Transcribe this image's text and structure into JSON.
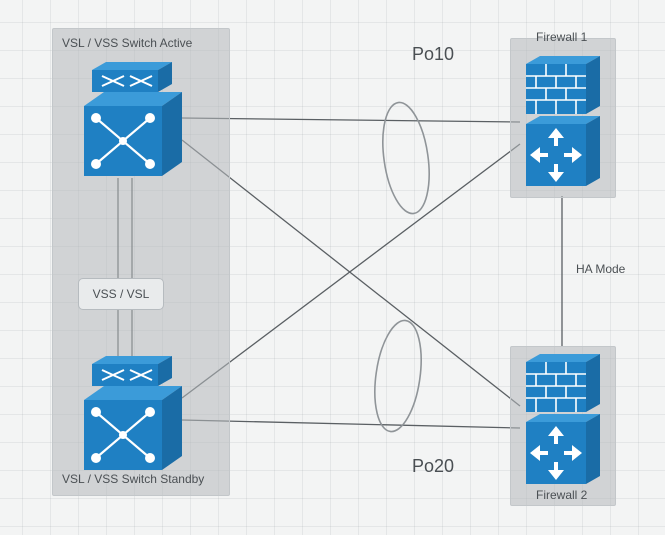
{
  "labels": {
    "vss_group_title": "VSL / VSS Switch  Active",
    "vss_standby_title": "VSL / VSS Switch Standby",
    "fw1_title": "Firewall 1",
    "fw2_title": "Firewall 2",
    "po10": "Po10",
    "po20": "Po20",
    "vsl_box": "VSS / VSL",
    "ha_mode": "HA Mode"
  },
  "colors": {
    "device_blue": "#1f80c3",
    "device_blue_dark": "#1a6ca6",
    "device_blue_top": "#3b9bd9",
    "line": "#5a5f63",
    "ellipse": "#8f9498"
  },
  "diagram": {
    "nodes": [
      {
        "id": "switch-active",
        "type": "switch",
        "group": "vss-group"
      },
      {
        "id": "switch-standby",
        "type": "switch",
        "group": "vss-group"
      },
      {
        "id": "vsl-link-box",
        "type": "label",
        "group": "vss-group"
      },
      {
        "id": "firewall-1",
        "type": "firewall",
        "group": "fw1-group"
      },
      {
        "id": "firewall-2",
        "type": "firewall",
        "group": "fw2-group"
      }
    ],
    "links": [
      {
        "from": "switch-active",
        "to": "firewall-1",
        "bundle": "Po10"
      },
      {
        "from": "switch-standby",
        "to": "firewall-1",
        "bundle": "Po10"
      },
      {
        "from": "switch-active",
        "to": "firewall-2",
        "bundle": "Po20"
      },
      {
        "from": "switch-standby",
        "to": "firewall-2",
        "bundle": "Po20"
      },
      {
        "from": "switch-active",
        "to": "switch-standby",
        "bundle": "VSL",
        "style": "double"
      },
      {
        "from": "firewall-1",
        "to": "firewall-2",
        "bundle": "HA"
      }
    ],
    "bundles": {
      "Po10": {
        "label_ref": "po10",
        "visual": "ellipse"
      },
      "Po20": {
        "label_ref": "po20",
        "visual": "ellipse"
      },
      "VSL": {
        "label_ref": "vsl_box"
      },
      "HA": {
        "label_ref": "ha_mode"
      }
    }
  }
}
